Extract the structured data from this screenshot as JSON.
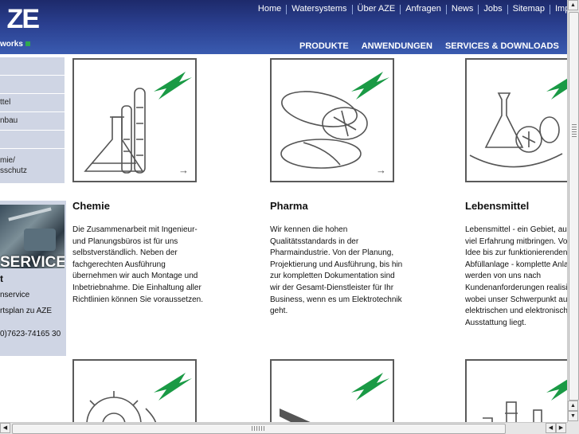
{
  "brand": {
    "logo_text": "ZE",
    "tagline": "works"
  },
  "topnav": [
    "Home",
    "Watersystems",
    "Über AZE",
    "Anfragen",
    "News",
    "Jobs",
    "Sitemap",
    "Impressum"
  ],
  "mainnav": [
    "PRODUKTE",
    "ANWENDUNGEN",
    "SERVICES & DOWNLOADS"
  ],
  "sidebar": {
    "items": [
      "",
      "",
      "ttel",
      "nbau",
      "",
      "mie/\nsschutz"
    ]
  },
  "service": {
    "photo_label": "SERVICE",
    "title": "t",
    "line1": "nservice",
    "line2": "rtsplan zu AZE",
    "phone": "0)7623-74165 30"
  },
  "cards": [
    {
      "title": "Chemie",
      "text": "Die Zusammenarbeit mit Ingenieur- und Planungsbüros ist für uns selbstverständlich. Neben der fachgerechten Ausführung übernehmen wir auch Montage und Inbetriebnahme. Die Einhaltung aller Richtlinien können Sie voraussetzen.",
      "icon": "lab-flasks-icon"
    },
    {
      "title": "Pharma",
      "text": "Wir kennen die hohen Qualitätsstandards in der Pharmaindustrie. Von der Planung, Projektierung und Ausführung, bis hin zur kompletten Dokumentation sind wir der Gesamt-Dienstleister für Ihr Business, wenn es um Elektrotechnik geht.",
      "icon": "pills-icon"
    },
    {
      "title": "Lebensmittel",
      "text": "Lebensmittel - ein Gebiet, auf viel Erfahrung mitbringen. Vor Idee bis zur funktionierenden Abfüllanlage - komplette Anlag werden von uns nach Kundenanforderungen realisie wobei unser Schwerpunkt au elektrischen und elektronisch Ausstattung liegt.",
      "icon": "fruit-flask-icon"
    }
  ],
  "arrow_glyph": "→",
  "colors": {
    "header": "#2a3f8f",
    "accent_green": "#1a9a45",
    "sidebar": "#cfd5e4"
  }
}
